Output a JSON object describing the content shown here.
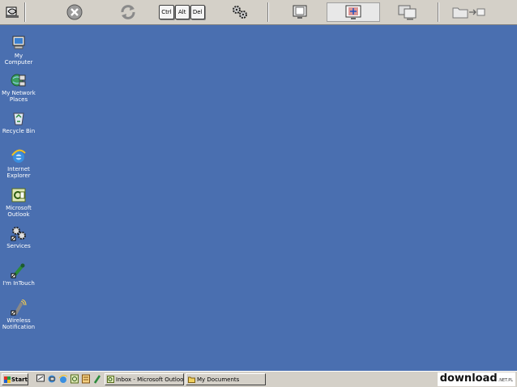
{
  "toolbar": {
    "keys": [
      "Ctrl",
      "Alt",
      "Del"
    ]
  },
  "desktop": {
    "icons": [
      {
        "label": "My Computer"
      },
      {
        "label": "My Network Places"
      },
      {
        "label": "Recycle Bin"
      },
      {
        "label": "Internet Explorer"
      },
      {
        "label": "Microsoft Outlook"
      },
      {
        "label": "Services"
      },
      {
        "label": "I'm InTouch"
      },
      {
        "label": "Wireless Notification"
      }
    ]
  },
  "taskbar": {
    "start_label": "Start",
    "tasks": [
      {
        "label": "Inbox - Microsoft Outlook"
      },
      {
        "label": "My Documents"
      }
    ]
  },
  "watermark": {
    "text": "download",
    "suffix": ".NET.PL"
  },
  "colors": {
    "desktop": "#4a6fb0",
    "chrome": "#d4d0c8"
  }
}
